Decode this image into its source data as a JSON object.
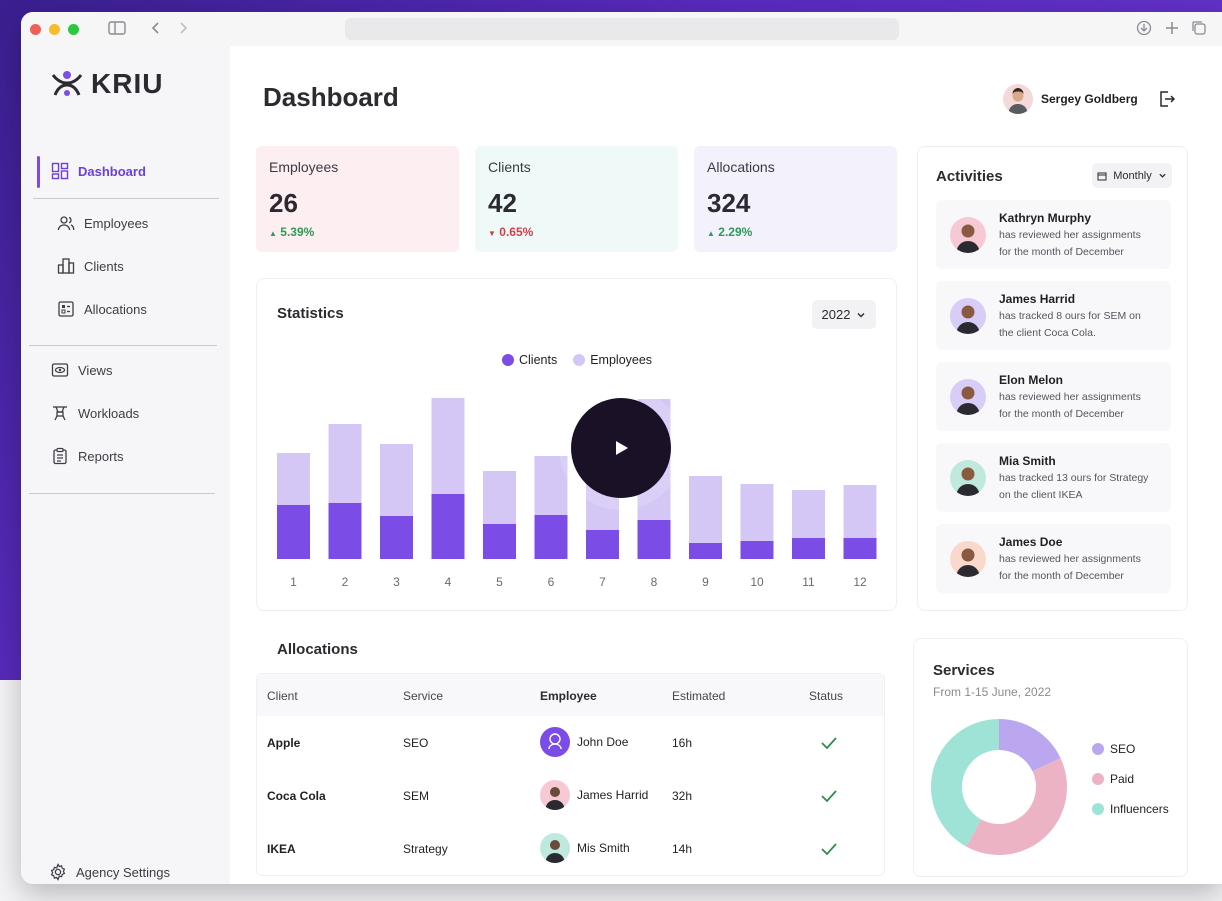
{
  "app": {
    "logo": "KRIU",
    "page_title": "Dashboard"
  },
  "user": {
    "name": "Sergey Goldberg"
  },
  "sidebar": {
    "items": [
      {
        "label": "Dashboard",
        "icon": "grid-icon",
        "active": true
      },
      {
        "label": "Employees",
        "icon": "users-icon"
      },
      {
        "label": "Clients",
        "icon": "building-icon"
      },
      {
        "label": "Allocations",
        "icon": "checklist-icon"
      },
      {
        "label": "Views",
        "icon": "eye-icon"
      },
      {
        "label": "Workloads",
        "icon": "drone-icon"
      },
      {
        "label": "Reports",
        "icon": "clipboard-icon"
      }
    ],
    "settings_label": "Agency Settings"
  },
  "stats": [
    {
      "label": "Employees",
      "value": "26",
      "change": "5.39%",
      "direction": "up",
      "color": "#fdeef1"
    },
    {
      "label": "Clients",
      "value": "42",
      "change": "0.65%",
      "direction": "down",
      "color": "#effaf8"
    },
    {
      "label": "Allocations",
      "value": "324",
      "change": "2.29%",
      "direction": "up",
      "color": "#f3f1fb"
    }
  ],
  "statistics": {
    "title": "Statistics",
    "year": "2022"
  },
  "chart_data": {
    "type": "bar",
    "stacked": true,
    "categories": [
      "1",
      "2",
      "3",
      "4",
      "5",
      "6",
      "7",
      "8",
      "9",
      "10",
      "11",
      "12"
    ],
    "series": [
      {
        "name": "Clients",
        "color": "#7c4ce6",
        "values": [
          54,
          56,
          43,
          65,
          35,
          44,
          29,
          39,
          16,
          18,
          21,
          21
        ]
      },
      {
        "name": "Employees",
        "color": "#d4c7f6",
        "values": [
          52,
          79,
          72,
          96,
          53,
          59,
          71,
          121,
          67,
          57,
          48,
          53
        ]
      }
    ],
    "ylim": [
      0,
      170
    ],
    "legend": "top-center"
  },
  "activities": {
    "title": "Activities",
    "filter": "Monthly",
    "items": [
      {
        "name": "Kathryn Murphy",
        "line1": "has reviewed her assignments",
        "line2": "for the month of December",
        "avatar_bg": "#f6c9d4"
      },
      {
        "name": "James Harrid",
        "line1": "has tracked 8 ours for SEM on",
        "line2": "the  client Coca Cola.",
        "avatar_bg": "#d7cdf6"
      },
      {
        "name": "Elon Melon",
        "line1": "has reviewed her assignments",
        "line2": "for the month of December",
        "avatar_bg": "#d7cdf6"
      },
      {
        "name": "Mia Smith",
        "line1": "has tracked 13 ours for Strategy",
        "line2": "on the  client IKEA",
        "avatar_bg": "#bfe9df"
      },
      {
        "name": "James Doe",
        "line1": "has reviewed her assignments",
        "line2": "for the month of December",
        "avatar_bg": "#f9d9cc"
      }
    ]
  },
  "allocations": {
    "title": "Allocations",
    "columns": [
      "Client",
      "Service",
      "Employee",
      "Estimated",
      "Status"
    ],
    "rows": [
      {
        "client": "Apple",
        "service": "SEO",
        "employee": "John Doe",
        "estimated": "16h",
        "avatar_bg": "#7c4ce6"
      },
      {
        "client": "Coca Cola",
        "service": "SEM",
        "employee": "James Harrid",
        "estimated": "32h",
        "avatar_bg": "#f6c9d4"
      },
      {
        "client": "IKEA",
        "service": "Strategy",
        "employee": "Mis Smith",
        "estimated": "14h",
        "avatar_bg": "#bfe9df"
      }
    ]
  },
  "services": {
    "title": "Services",
    "subtitle": "From 1-15 June, 2022",
    "slices": [
      {
        "label": "SEO",
        "value": 18,
        "color": "#bba7f0"
      },
      {
        "label": "Paid",
        "value": 40,
        "color": "#ecb3c4"
      },
      {
        "label": "Influencers",
        "value": 42,
        "color": "#9fe3d6"
      }
    ]
  }
}
